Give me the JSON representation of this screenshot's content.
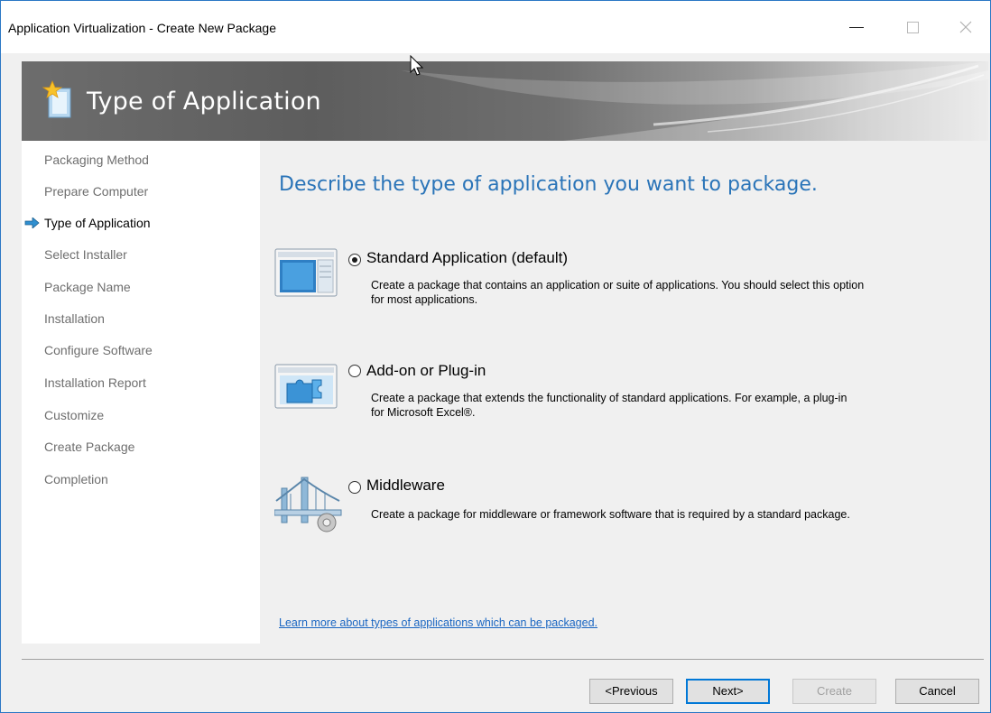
{
  "window": {
    "title": "Application Virtualization - Create New Package"
  },
  "banner": {
    "title": "Type of Application"
  },
  "sidebar": {
    "items": [
      {
        "label": "Packaging Method",
        "current": false
      },
      {
        "label": "Prepare Computer",
        "current": false
      },
      {
        "label": "Type of Application",
        "current": true
      },
      {
        "label": "Select Installer",
        "current": false
      },
      {
        "label": "Package Name",
        "current": false
      },
      {
        "label": "Installation",
        "current": false
      },
      {
        "label": "Configure Software",
        "current": false
      },
      {
        "label": "Installation Report",
        "current": false
      },
      {
        "label": "Customize",
        "current": false
      },
      {
        "label": "Create Package",
        "current": false
      },
      {
        "label": "Completion",
        "current": false
      }
    ]
  },
  "main": {
    "heading": "Describe the type of application you want to package.",
    "options": [
      {
        "label": "Standard Application (default)",
        "desc_line1": "Create a package that contains an application or suite of applications. You should select this option",
        "desc_line2": "for most applications.",
        "selected": true,
        "icon": "standard-application-icon"
      },
      {
        "label": "Add-on or Plug-in",
        "desc_line1": "Create a package that extends the functionality of standard applications. For example, a plug-in",
        "desc_line2": "for Microsoft Excel®.",
        "selected": false,
        "icon": "plugin-puzzle-icon"
      },
      {
        "label": "Middleware",
        "desc_line1": "Create a package for middleware or framework software that is required by a standard package.",
        "desc_line2": "",
        "selected": false,
        "icon": "middleware-bridge-icon"
      }
    ],
    "learn_more": "Learn more about types of applications which can be packaged."
  },
  "footer": {
    "previous": "<Previous",
    "next": "Next>",
    "create": "Create",
    "cancel": "Cancel"
  },
  "colors": {
    "heading": "#2a74b8",
    "link": "#1a66c2",
    "accent": "#0078d7"
  }
}
